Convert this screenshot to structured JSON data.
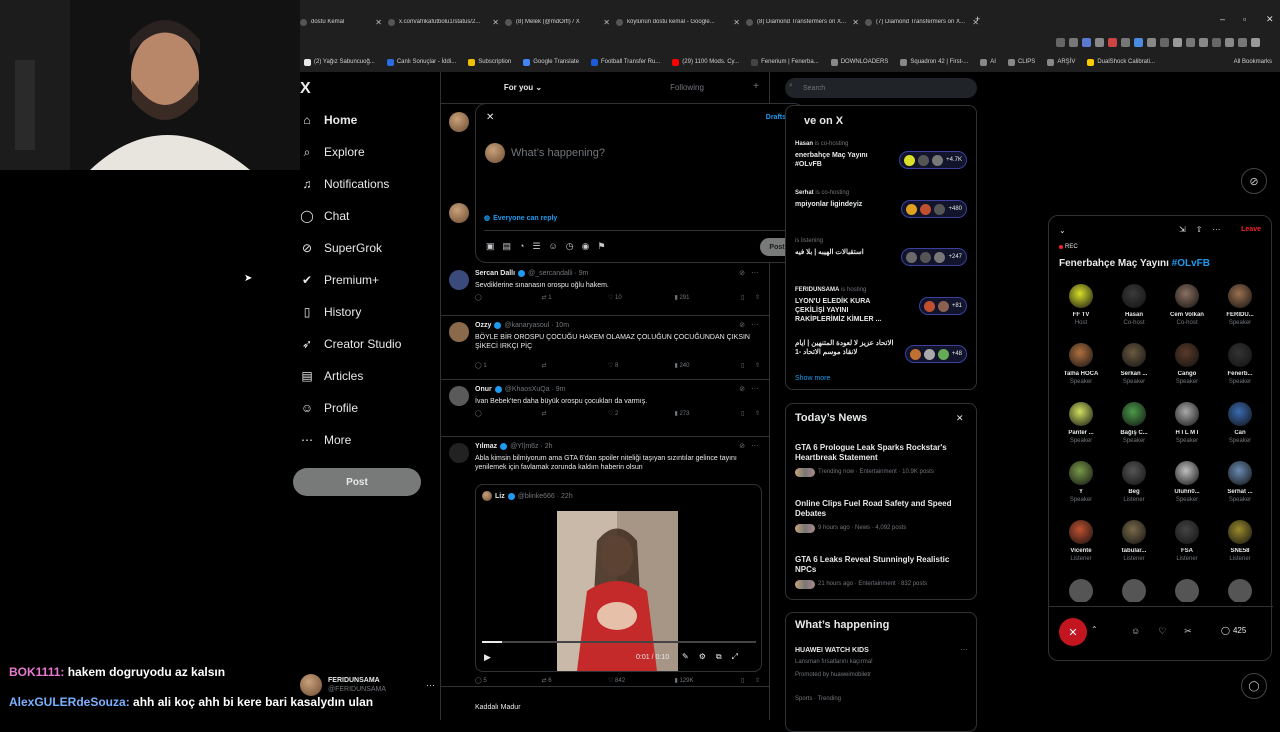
{
  "browser": {
    "tabs": [
      {
        "title": "dostu Kemal"
      },
      {
        "title": "x.com/afrikafutbolu1/status/2..."
      },
      {
        "title": "(8) Melek (@mdOrfl) / X"
      },
      {
        "title": "köylünün dostu kemal - Google..."
      },
      {
        "title": "(8) Diamond Transfermers on X..."
      },
      {
        "title": "(7) Diamond Transfermers on X..."
      }
    ],
    "new_tab": "+",
    "window_controls": [
      "–",
      "▫",
      "✕"
    ],
    "bookmarks": [
      {
        "label": "(2) Yağız Sabuncuoğ...",
        "color": "#e7e9ea"
      },
      {
        "label": "Canlı Sonuçlar - İddi...",
        "color": "#2b6de0"
      },
      {
        "label": "Subscription",
        "color": "#f2c200"
      },
      {
        "label": "Google Translate",
        "color": "#4285f4"
      },
      {
        "label": "Football Transfer Ru...",
        "color": "#1e5bd8"
      },
      {
        "label": "(29) 1100 Mods. Cy...",
        "color": "#ff0000"
      },
      {
        "label": "Fenerium | Fenerba...",
        "color": "#444"
      },
      {
        "label": "DOWNLOADERS",
        "color": "#888"
      },
      {
        "label": "Squadron 42 | First-...",
        "color": "#888"
      },
      {
        "label": "AI",
        "color": "#888"
      },
      {
        "label": "CLIPS",
        "color": "#888"
      },
      {
        "label": "ARŞİV",
        "color": "#888"
      },
      {
        "label": "DualShock Calibrati...",
        "color": "#ffcc00"
      }
    ],
    "all_bookmarks": "All Bookmarks"
  },
  "sidebar": {
    "logo": "X",
    "items": [
      {
        "label": "Home",
        "icon": "⌂",
        "bold": true
      },
      {
        "label": "Explore",
        "icon": "⌕"
      },
      {
        "label": "Notifications",
        "icon": "♫"
      },
      {
        "label": "Chat",
        "icon": "◯"
      },
      {
        "label": "SuperGrok",
        "icon": "⊘"
      },
      {
        "label": "Premium+",
        "icon": "✔"
      },
      {
        "label": "History",
        "icon": "▯"
      },
      {
        "label": "Creator Studio",
        "icon": "➶"
      },
      {
        "label": "Articles",
        "icon": "▤"
      },
      {
        "label": "Profile",
        "icon": "☺"
      },
      {
        "label": "More",
        "icon": "⋯"
      }
    ],
    "post_button": "Post",
    "account": {
      "name": "FERIDUNSAMA",
      "handle": "@FERIDUNSAMA",
      "more": "···"
    }
  },
  "feed": {
    "tabs": [
      {
        "label": "For you ⌄"
      },
      {
        "label": "Following"
      }
    ],
    "plus": "+",
    "tweets": [
      {
        "name": "Sercan Dallı",
        "handle": "@_sercandalli · 9m",
        "text": "Sevdiklerine sınanasın orospu oğlu hakem.",
        "reply": "",
        "retweet": "1",
        "like": "10",
        "views": "291",
        "avatar": "#3a4a7a"
      },
      {
        "name": "Ozzy",
        "handle": "@kanaryasoul · 10m",
        "text": "BÖYLE BİR OROSPU ÇOCUĞU HAKEM OLAMAZ ÇOLUĞUN ÇOCUĞUNDAN ÇIKSIN ŞİKECİ IRKÇI PİÇ",
        "reply": "1",
        "retweet": "",
        "like": "8",
        "views": "240",
        "avatar": "#8a6a4a"
      },
      {
        "name": "Onur",
        "handle": "@KhaosXuQa · 9m",
        "text": "İvan Bebek'ten daha büyük orospu çocukları da varmış.",
        "reply": "",
        "retweet": "",
        "like": "2",
        "views": "273",
        "avatar": "#5a5a5a"
      },
      {
        "name": "Yılmaz",
        "handle": "@Yl|m6z · 2h",
        "text": "Abla kimsin bilmiyorum ama GTA 6'dan spoiler niteliği taşıyan sızıntılar gelince tayını yenilemek için favlamak zorunda kaldım haberin olsun",
        "reply": "5",
        "retweet": "6",
        "like": "842",
        "views": "129K",
        "avatar": "#222"
      }
    ],
    "quote": {
      "name": "Liz",
      "handle": "@blinke666 · 22h",
      "time": "0:01 / 0:10"
    },
    "next_name": "Kaddalı Madur"
  },
  "compose": {
    "close": "✕",
    "drafts": "Drafts",
    "placeholder": "What’s happening?",
    "reply_setting": "Everyone can reply",
    "post": "Post",
    "tools": [
      "▣",
      "▤",
      "◔",
      "☰",
      "☺",
      "◷",
      "◉",
      "⚑"
    ]
  },
  "right": {
    "search_placeholder": "Search",
    "live": {
      "title": "ve on X",
      "items": [
        {
          "host": "Hasan",
          "role": "is co-hosting",
          "title": "enerbahçe Maç Yayını #OLvFB",
          "count": "+4.7K"
        },
        {
          "host": "Serhat",
          "role": "is co-hosting",
          "title": "mpiyonlar ligindeyiz",
          "count": "+480"
        },
        {
          "host": "",
          "role": "is listening",
          "title": "استقبالات الهيبه | بلا فيه",
          "count": "+247"
        },
        {
          "host": "FERIDUNSAMA",
          "role": "is hosting",
          "title": "LYON'U ELEDİK KURA ÇEKİLİŞİ YAYINI RAKİPLERİMİZ KİMLER ...",
          "count": "+81"
        },
        {
          "host": "",
          "role": "",
          "title": "الاتحاد عزيز لا لعودة المتنهين | ايام لانقاذ موسم الاتحاد -1",
          "count": "+48"
        }
      ],
      "show_more": "Show more"
    },
    "news": {
      "heading": "Today’s News",
      "close": "✕",
      "items": [
        {
          "title": "GTA 6 Prologue Leak Sparks Rockstar's Heartbreak Statement",
          "meta": "Trending now · Entertainment · 10.9K posts"
        },
        {
          "title": "Online Clips Fuel Road Safety and Speed Debates",
          "meta": "9 hours ago · News · 4,092 posts"
        },
        {
          "title": "GTA 6 Leaks Reveal Stunningly Realistic NPCs",
          "meta": "21 hours ago · Entertainment · 832 posts"
        }
      ]
    },
    "happening": {
      "heading": "What’s happening",
      "item_title": "HUAWEI WATCH KIDS",
      "item_sub": "Lansman fırsatlarını kaçırma!",
      "item_promo": "Promoted by huaweimobiletr",
      "next_meta": "Sports · Trending"
    }
  },
  "spaces": {
    "leave": "Leave",
    "rec": "REC",
    "title": "Fenerbahçe Maç Yayını ",
    "hashtag": "#OLvFB",
    "reply_count": "425",
    "speakers": [
      {
        "name": "FF TV",
        "role": "Host",
        "color": "#d8e02a"
      },
      {
        "name": "Hasan",
        "role": "Co-host",
        "color": "#3a3a3a"
      },
      {
        "name": "Cem Volkan",
        "role": "Co-host",
        "color": "#8a7060"
      },
      {
        "name": "FERIDU...",
        "role": "Speaker",
        "color": "#9a7050"
      },
      {
        "name": "Talha HOCA",
        "role": "Speaker",
        "color": "#b07040"
      },
      {
        "name": "Serkan ...",
        "role": "Speaker",
        "color": "#6a5a40"
      },
      {
        "name": "Cango",
        "role": "Speaker",
        "color": "#5a3a2a"
      },
      {
        "name": "Fenerb...",
        "role": "Speaker",
        "color": "#333"
      },
      {
        "name": "Panter ...",
        "role": "Speaker",
        "color": "#d0e060"
      },
      {
        "name": "Bağış C...",
        "role": "Speaker",
        "color": "#4a9a4a"
      },
      {
        "name": "H İ L M İ",
        "role": "Speaker",
        "color": "#aaa"
      },
      {
        "name": "Can",
        "role": "Speaker",
        "color": "#3a6ab0"
      },
      {
        "name": "Y",
        "role": "Speaker",
        "color": "#7a9a4a"
      },
      {
        "name": "Beg",
        "role": "Listener",
        "color": "#555"
      },
      {
        "name": "Uluhn0...",
        "role": "Speaker",
        "color": "#c0c0c0"
      },
      {
        "name": "Serhat ...",
        "role": "Speaker",
        "color": "#6a8ab0"
      },
      {
        "name": "Vicente",
        "role": "Listener",
        "color": "#c05030"
      },
      {
        "name": "tabular...",
        "role": "Listener",
        "color": "#7a6a4a"
      },
      {
        "name": "FSA",
        "role": "Listener",
        "color": "#444"
      },
      {
        "name": "SNE58",
        "role": "Listener",
        "color": "#9a8a2a"
      }
    ]
  },
  "chat_overlay": [
    {
      "user": "BOK1111:",
      "msg": " hakem dogruyodu az kalsın",
      "color": "#e87ad0"
    },
    {
      "user": "AlexGULERdeSouza:",
      "msg": " ahh ali koç ahh bi kere bari kasalydın ulan",
      "color": "#7ab0ff"
    }
  ]
}
